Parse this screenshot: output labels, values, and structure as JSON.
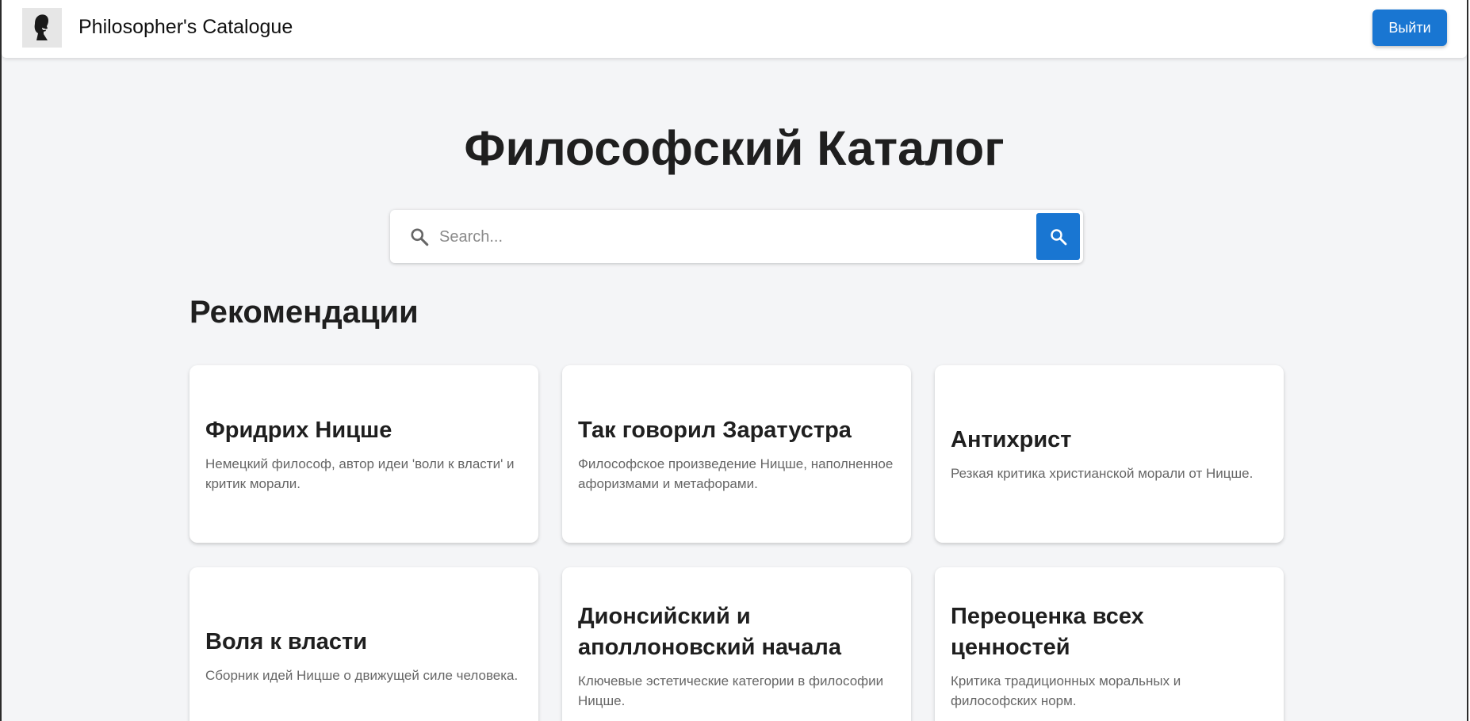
{
  "header": {
    "app_title": "Philosopher's Catalogue",
    "logout_label": "Выйти",
    "logo_icon": "philosopher-portrait-icon"
  },
  "main": {
    "heading": "Философский Каталог",
    "search": {
      "placeholder": "Search...",
      "value": "",
      "icon": "search-icon",
      "button_icon": "search-icon"
    },
    "section_title": "Рекомендации",
    "cards": [
      {
        "title": "Фридрих Ницше",
        "description": "Немецкий философ, автор идеи 'воли к власти' и критик морали."
      },
      {
        "title": "Так говорил Заратустра",
        "description": "Философское произведение Ницше, наполненное афоризмами и метафорами."
      },
      {
        "title": "Антихрист",
        "description": "Резкая критика христианской морали от Ницше."
      },
      {
        "title": "Воля к власти",
        "description": "Сборник идей Ницше о движущей силе человека."
      },
      {
        "title": "Дионсийский и аполлоновский начала",
        "description": "Ключевые эстетические категории в философии Ницше."
      },
      {
        "title": "Переоценка всех ценностей",
        "description": "Критика традиционных моральных и философских норм."
      }
    ]
  },
  "colors": {
    "accent": "#1976d2",
    "page_background": "#f4f5f7",
    "card_background": "#ffffff"
  }
}
